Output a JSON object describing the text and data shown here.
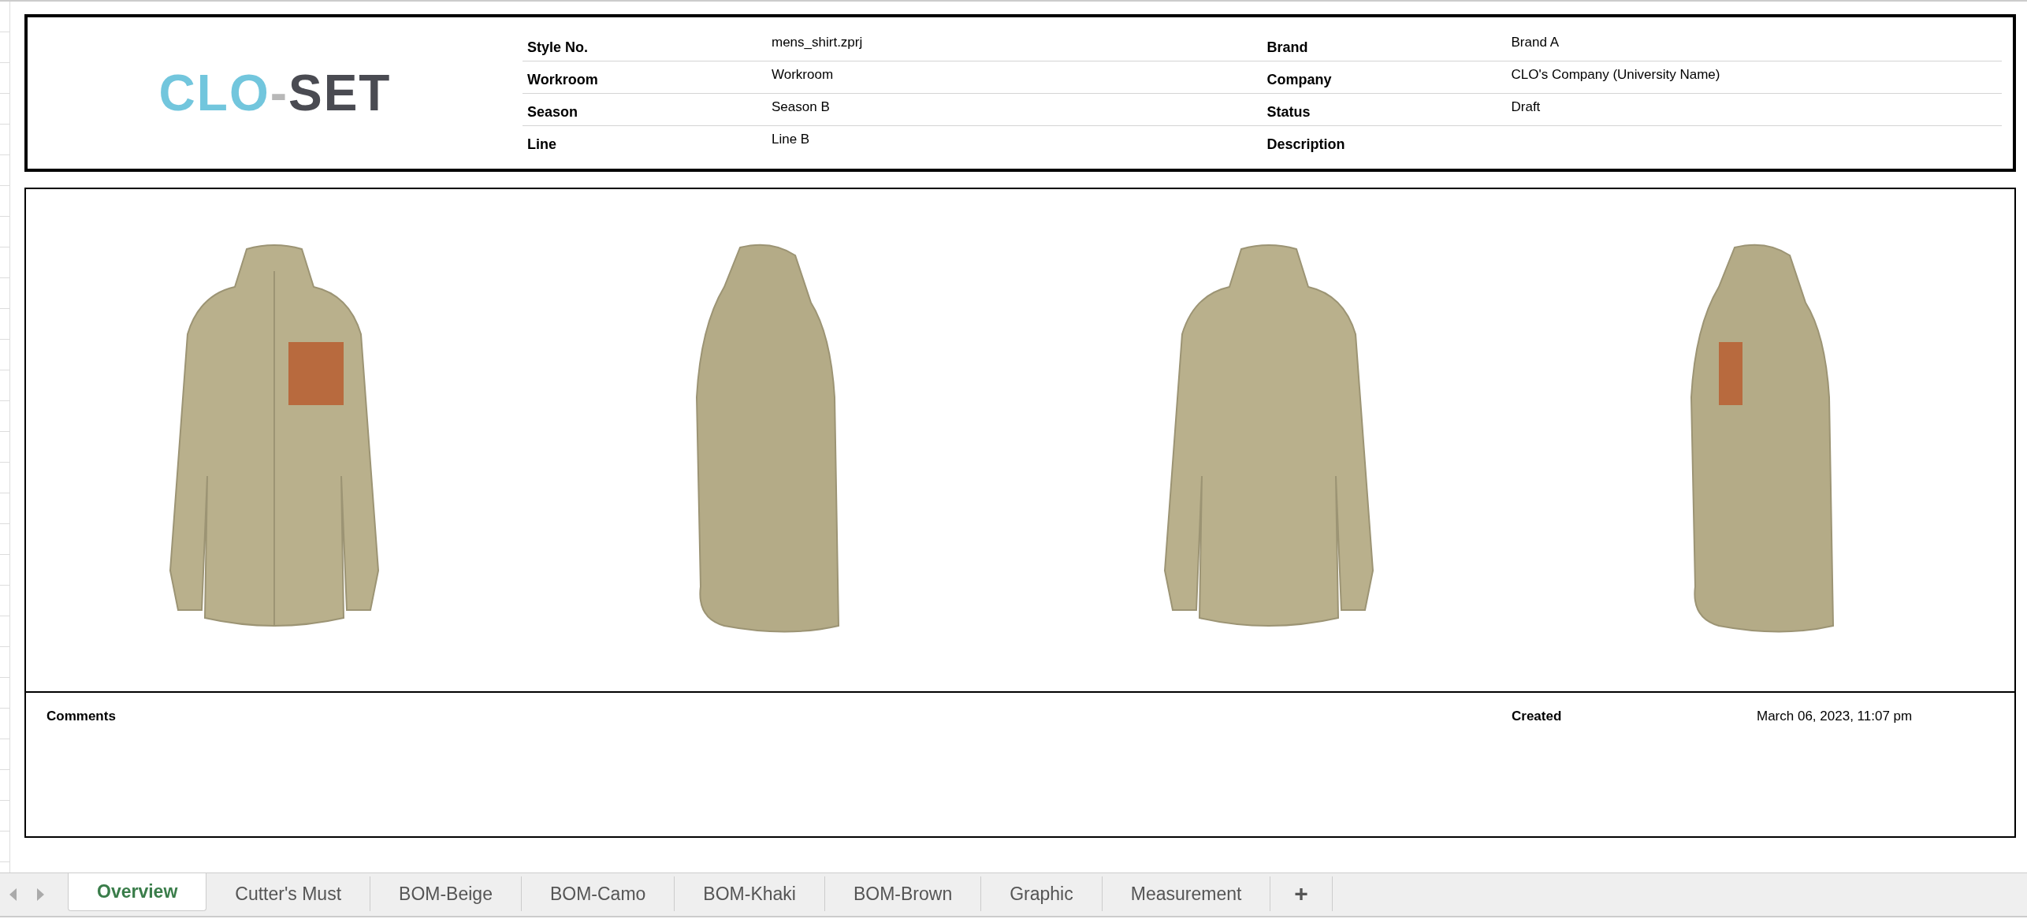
{
  "logo": [
    {
      "text": "CLO",
      "color": "#72c6dd"
    },
    {
      "text": "-",
      "color": "#b8b8b8"
    },
    {
      "text": "SET",
      "color": "#4a4b52"
    }
  ],
  "details_left": [
    {
      "label": "Style No.",
      "value": "mens_shirt.zprj"
    },
    {
      "label": "Workroom",
      "value": "Workroom"
    },
    {
      "label": "Season",
      "value": "Season B"
    },
    {
      "label": "Line",
      "value": "Line B"
    }
  ],
  "details_right": [
    {
      "label": "Brand",
      "value": "Brand A"
    },
    {
      "label": "Company",
      "value": "CLO's Company (University Name)"
    },
    {
      "label": "Status",
      "value": "Draft"
    },
    {
      "label": "Description"
    }
  ],
  "comments": {
    "label": "Comments",
    "created_label": "Created",
    "created_value": "March 06, 2023, 11:07 pm"
  },
  "sheet_tabs": [
    {
      "label": "Overview",
      "selected": true
    },
    {
      "label": "Cutter's Must",
      "selected": false
    },
    {
      "label": "BOM-Beige",
      "selected": false
    },
    {
      "label": "BOM-Camo",
      "selected": false
    },
    {
      "label": "BOM-Khaki",
      "selected": false
    },
    {
      "label": "BOM-Brown",
      "selected": false
    },
    {
      "label": "Graphic",
      "selected": false
    },
    {
      "label": "Measurement",
      "selected": false
    }
  ],
  "add_tab": "+"
}
